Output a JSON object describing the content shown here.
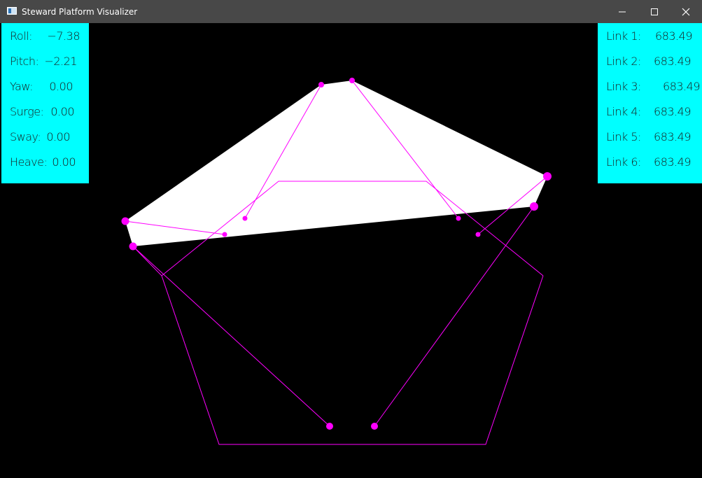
{
  "window": {
    "title": "Steward Platform Visualizer",
    "minimize_icon": "minimize-icon",
    "maximize_icon": "maximize-icon",
    "close_icon": "close-icon"
  },
  "pose_panel": {
    "rows": [
      {
        "label": "Roll:",
        "value": "−7.38"
      },
      {
        "label": "Pitch:",
        "value": "−2.21"
      },
      {
        "label": "Yaw:",
        "value": "0.00"
      },
      {
        "label": "Surge:",
        "value": "0.00"
      },
      {
        "label": "Sway:",
        "value": "0.00"
      },
      {
        "label": "Heave:",
        "value": "0.00"
      }
    ]
  },
  "links_panel": {
    "rows": [
      {
        "label": "Link 1:",
        "value": "683.49"
      },
      {
        "label": "Link 2:",
        "value": "683.49"
      },
      {
        "label": "Link 3:",
        "value": "683.49"
      },
      {
        "label": "Link 4:",
        "value": "683.49"
      },
      {
        "label": "Link 5:",
        "value": "683.49"
      },
      {
        "label": "Link 6:",
        "value": "683.49"
      }
    ]
  },
  "colors": {
    "background": "#000000",
    "platform": "#ffffff",
    "wireframe": "#ff00ff",
    "panel": "#00ffff",
    "titlebar": "#484848"
  }
}
